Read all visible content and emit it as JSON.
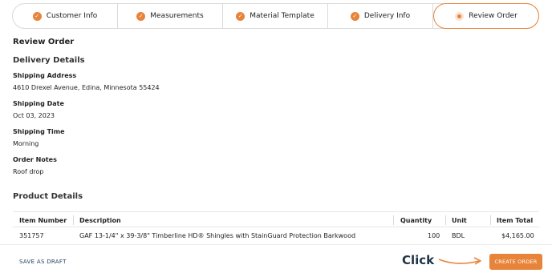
{
  "steps": [
    {
      "label": "Customer Info",
      "icon": "check-circle-icon",
      "state": "done"
    },
    {
      "label": "Measurements",
      "icon": "check-circle-icon",
      "state": "done"
    },
    {
      "label": "Material Template",
      "icon": "check-circle-icon",
      "state": "done"
    },
    {
      "label": "Delivery Info",
      "icon": "check-circle-icon",
      "state": "done"
    },
    {
      "label": "Review Order",
      "icon": "current-step-dot-icon",
      "state": "active"
    }
  ],
  "page_title": "Review Order",
  "delivery": {
    "heading": "Delivery Details",
    "shipping_address_label": "Shipping Address",
    "shipping_address": "4610 Drexel Avenue, Edina, Minnesota 55424",
    "shipping_date_label": "Shipping Date",
    "shipping_date": "Oct 03, 2023",
    "shipping_time_label": "Shipping Time",
    "shipping_time": "Morning",
    "order_notes_label": "Order Notes",
    "order_notes": "Roof drop"
  },
  "product": {
    "heading": "Product Details",
    "columns": [
      "Item Number",
      "Description",
      "Quantity",
      "Unit",
      "Item Total"
    ],
    "rows": [
      [
        "351757",
        "GAF 13-1/4\" x 39-3/8\" Timberline HD® Shingles with StainGuard Protection Barkwood",
        "100",
        "BDL",
        "$4,165.00"
      ]
    ]
  },
  "footer": {
    "save_draft": "SAVE AS DRAFT",
    "annotation": "Click",
    "create_order": "CREATE ORDER"
  },
  "colors": {
    "accent": "#e8833a",
    "navy": "#1e3a5a"
  }
}
